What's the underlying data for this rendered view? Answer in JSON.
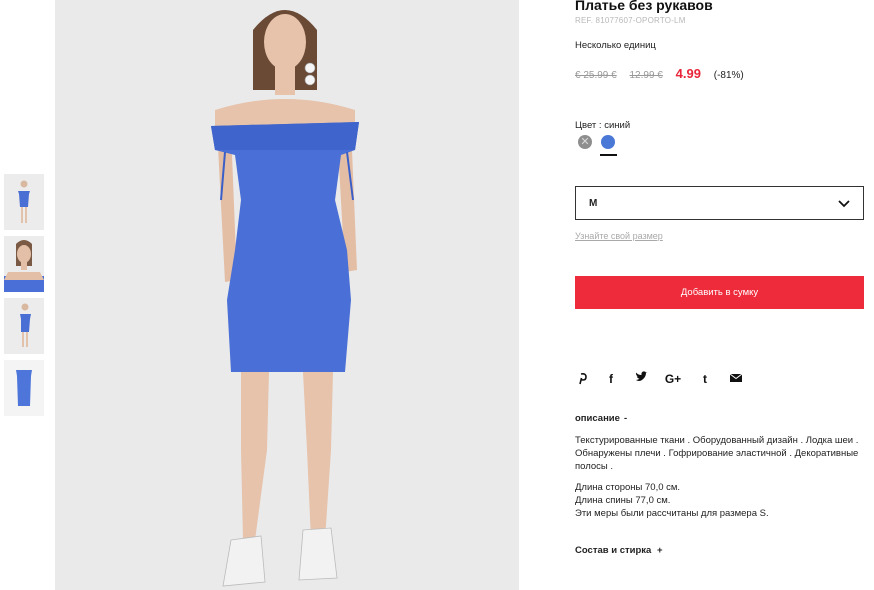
{
  "product": {
    "title": "Платье без рукавов",
    "ref": "REF. 81077607-OPORTO-LM",
    "stock": "Несколько единиц",
    "old_price_1": "€ 25.99 €",
    "old_price_2": "12.99 €",
    "price": "4.99",
    "discount": "(-81%)"
  },
  "color": {
    "label": "Цвет : синий",
    "swatches": [
      "grey",
      "blue"
    ],
    "colors": {
      "grey": "#8e8e8e",
      "blue": "#4a78d6"
    }
  },
  "size": {
    "selected": "M",
    "guide_link": "Узнайте свой размер"
  },
  "cart": {
    "button_label": "Добавить в сумку",
    "button_color": "#ee2b3b"
  },
  "social": {
    "icons": [
      "pinterest-icon",
      "facebook-icon",
      "twitter-icon",
      "google-plus-icon",
      "tumblr-icon",
      "email-icon"
    ],
    "glyphs": [
      "℗",
      "f",
      "🐦",
      "G+",
      "t",
      "✉"
    ]
  },
  "description": {
    "heading": "описание",
    "toggle": "-",
    "text": "Текстурированные ткани . Оборудованный дизайн . Лодка шеи . Обнаружены плечи . Гофрирование эластичной . Декоративные полосы .",
    "side_length": "Длина стороны 70,0 см.",
    "back_length": "Длина спины 77,0 см.",
    "size_note": "Эти меры были рассчитаны для размера S."
  },
  "composition": {
    "heading": "Состав и стирка",
    "toggle": "+"
  }
}
